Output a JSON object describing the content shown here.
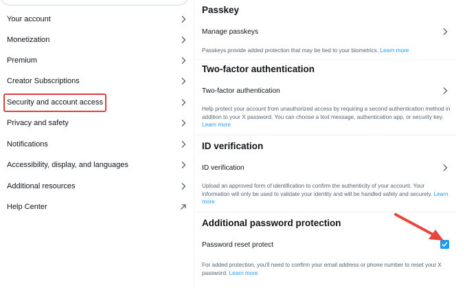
{
  "sidebar": {
    "items": [
      {
        "label": "Your account",
        "icon": "chevron-right-icon"
      },
      {
        "label": "Monetization",
        "icon": "chevron-right-icon"
      },
      {
        "label": "Premium",
        "icon": "chevron-right-icon"
      },
      {
        "label": "Creator Subscriptions",
        "icon": "chevron-right-icon"
      },
      {
        "label": "Security and account access",
        "icon": "chevron-right-icon",
        "highlighted": true
      },
      {
        "label": "Privacy and safety",
        "icon": "chevron-right-icon"
      },
      {
        "label": "Notifications",
        "icon": "chevron-right-icon"
      },
      {
        "label": "Accessibility, display, and languages",
        "icon": "chevron-right-icon"
      },
      {
        "label": "Additional resources",
        "icon": "chevron-right-icon"
      },
      {
        "label": "Help Center",
        "icon": "external-arrow-icon"
      }
    ]
  },
  "main": {
    "passkey": {
      "title": "Passkey",
      "row_label": "Manage passkeys",
      "description": "Passkeys provide added protection that may be tied to your biometrics.",
      "learn_more": "Learn more"
    },
    "two_factor": {
      "title": "Two-factor authentication",
      "row_label": "Two-factor authentication",
      "description": "Help protect your account from unauthorized access by requiring a second authentication method in addition to your X password. You can choose a text message, authentication app, or security key.",
      "learn_more": "Learn more"
    },
    "id_verification": {
      "title": "ID verification",
      "row_label": "ID verification",
      "description": "Upload an approved form of identification to confirm the authenticity of your account. Your information will only be used to validate your identity and will be handled safely and securely.",
      "learn_more": "Learn more"
    },
    "password_protection": {
      "title": "Additional password protection",
      "row_label": "Password reset protect",
      "checked": true,
      "description": "For added protection, you'll need to confirm your email address or phone number to reset your X password.",
      "learn_more": "Learn more"
    }
  },
  "colors": {
    "accent": "#1d9bf0",
    "highlight_box": "#e0393e",
    "annotation_arrow": "#e8453c",
    "secondary_text": "#536471"
  }
}
